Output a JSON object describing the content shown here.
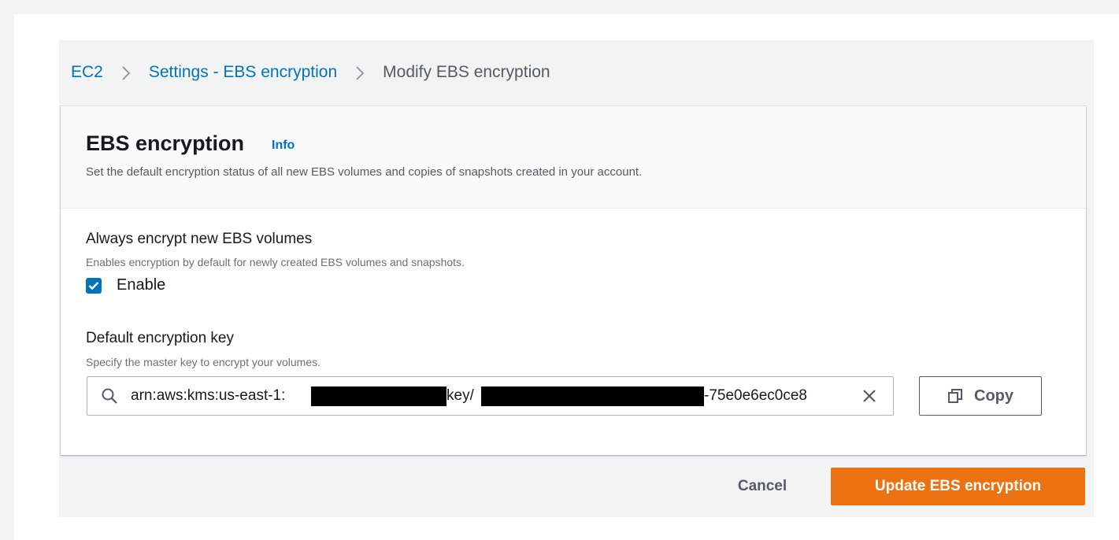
{
  "breadcrumb": {
    "items": [
      "EC2",
      "Settings - EBS encryption"
    ],
    "current": "Modify EBS encryption"
  },
  "panel": {
    "title": "EBS encryption",
    "info_label": "Info",
    "description": "Set the default encryption status of all new EBS volumes and copies of snapshots created in your account."
  },
  "always_encrypt": {
    "label": "Always encrypt new EBS volumes",
    "description": "Enables encryption by default for newly created EBS volumes and snapshots.",
    "checkbox_label": "Enable",
    "checked": true
  },
  "default_key": {
    "label": "Default encryption key",
    "description": "Specify the master key to encrypt your volumes.",
    "value_prefix": "arn:aws:kms:us-east-1:",
    "value_middle": "key/",
    "value_suffix": "-75e0e6ec0ce8",
    "copy_label": "Copy"
  },
  "footer": {
    "cancel_label": "Cancel",
    "submit_label": "Update EBS encryption"
  },
  "colors": {
    "link": "#0073bb",
    "primary": "#ec7211",
    "text": "#16191f",
    "muted": "#545b64"
  },
  "icons": [
    "chevron-right-icon",
    "search-icon",
    "close-icon",
    "copy-icon",
    "checkmark-icon"
  ]
}
